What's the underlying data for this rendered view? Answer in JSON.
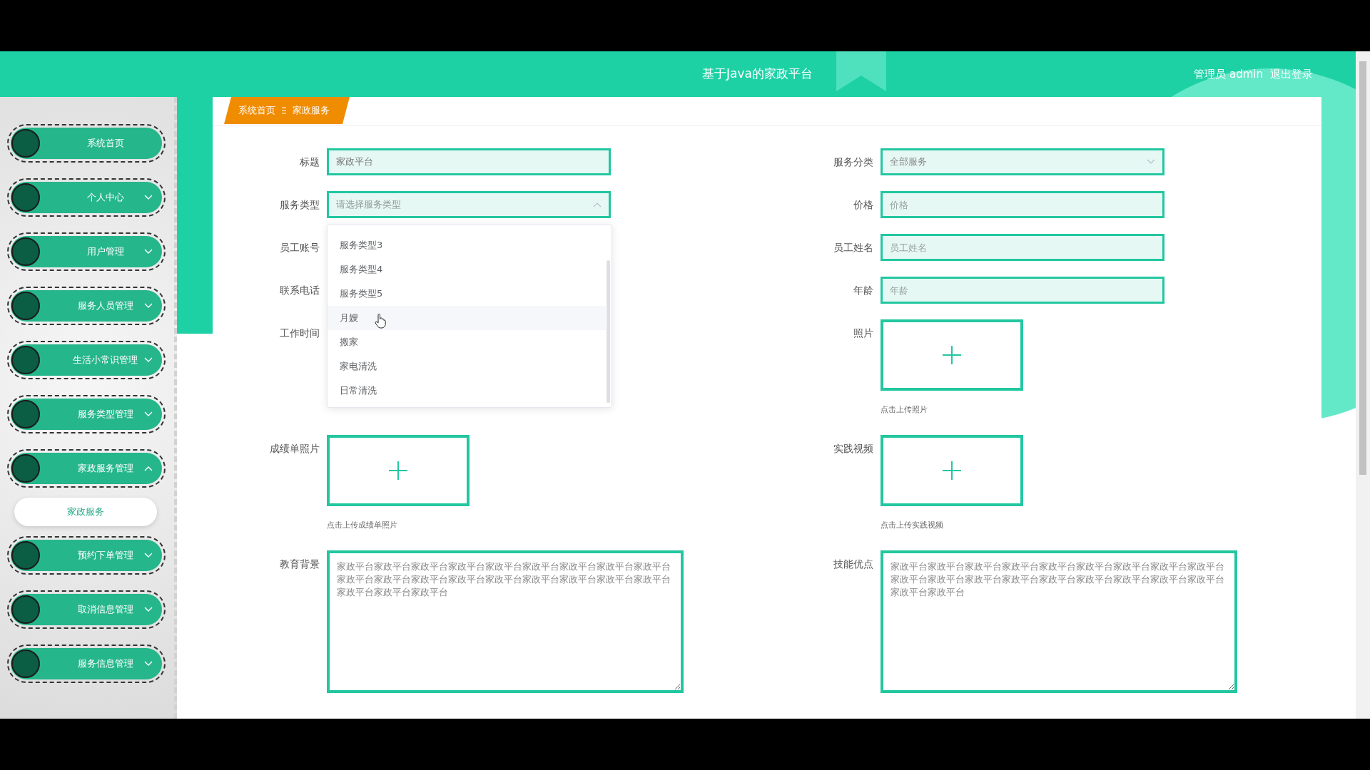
{
  "header": {
    "title": "基于Java的家政平台",
    "user": "管理员 admin",
    "logout": "退出登录"
  },
  "sidebar": {
    "items": [
      {
        "label": "系统首页",
        "kind": "link"
      },
      {
        "label": "个人中心",
        "kind": "menu",
        "expanded": false
      },
      {
        "label": "用户管理",
        "kind": "menu",
        "expanded": false
      },
      {
        "label": "服务人员管理",
        "kind": "menu",
        "expanded": false
      },
      {
        "label": "生活小常识管理",
        "kind": "menu",
        "expanded": false
      },
      {
        "label": "服务类型管理",
        "kind": "menu",
        "expanded": false
      },
      {
        "label": "家政服务管理",
        "kind": "menu",
        "expanded": true,
        "children": [
          {
            "label": "家政服务",
            "selected": true
          }
        ]
      },
      {
        "label": "预约下单管理",
        "kind": "menu",
        "expanded": false
      },
      {
        "label": "取消信息管理",
        "kind": "menu",
        "expanded": false
      },
      {
        "label": "服务信息管理",
        "kind": "menu",
        "expanded": false
      }
    ]
  },
  "breadcrumb": [
    "系统首页",
    "家政服务"
  ],
  "form": {
    "rows": [
      [
        {
          "label": "标题",
          "kind": "input",
          "value": "家政平台"
        },
        {
          "label": "服务分类",
          "kind": "select",
          "value": "全部服务",
          "expanded": false
        }
      ],
      [
        {
          "label": "服务类型",
          "kind": "select",
          "placeholder": "请选择服务类型",
          "expanded": true
        },
        {
          "label": "价格",
          "kind": "input",
          "placeholder": "价格"
        }
      ],
      [
        {
          "label": "员工账号",
          "kind": "covered"
        },
        {
          "label": "员工姓名",
          "kind": "input",
          "placeholder": "员工姓名"
        }
      ],
      [
        {
          "label": "联系电话",
          "kind": "covered"
        },
        {
          "label": "年龄",
          "kind": "input",
          "placeholder": "年龄"
        }
      ],
      [
        {
          "label": "工作时间",
          "kind": "covered"
        },
        {
          "label": "照片",
          "kind": "upload",
          "hint": "点击上传照片"
        }
      ],
      [
        {
          "label": "成绩单照片",
          "kind": "upload",
          "hint": "点击上传成绩单照片"
        },
        {
          "label": "实践视频",
          "kind": "upload",
          "hint": "点击上传实践视频"
        }
      ],
      [
        {
          "label": "教育背景",
          "kind": "textarea",
          "value": "家政平台家政平台家政平台家政平台家政平台家政平台家政平台家政平台家政平台家政平台家政平台家政平台家政平台家政平台家政平台家政平台家政平台家政平台家政平台家政平台家政平台"
        },
        {
          "label": "技能优点",
          "kind": "textarea",
          "value": "家政平台家政平台家政平台家政平台家政平台家政平台家政平台家政平台家政平台家政平台家政平台家政平台家政平台家政平台家政平台家政平台家政平台家政平台家政平台家政平台"
        }
      ]
    ]
  },
  "dropdown": {
    "options": [
      {
        "label": "服务类型3",
        "hovered": false
      },
      {
        "label": "服务类型4",
        "hovered": false
      },
      {
        "label": "服务类型5",
        "hovered": false
      },
      {
        "label": "月嫂",
        "hovered": true
      },
      {
        "label": "搬家",
        "hovered": false
      },
      {
        "label": "家电清洗",
        "hovered": false
      },
      {
        "label": "日常清洗",
        "hovered": false
      }
    ]
  }
}
